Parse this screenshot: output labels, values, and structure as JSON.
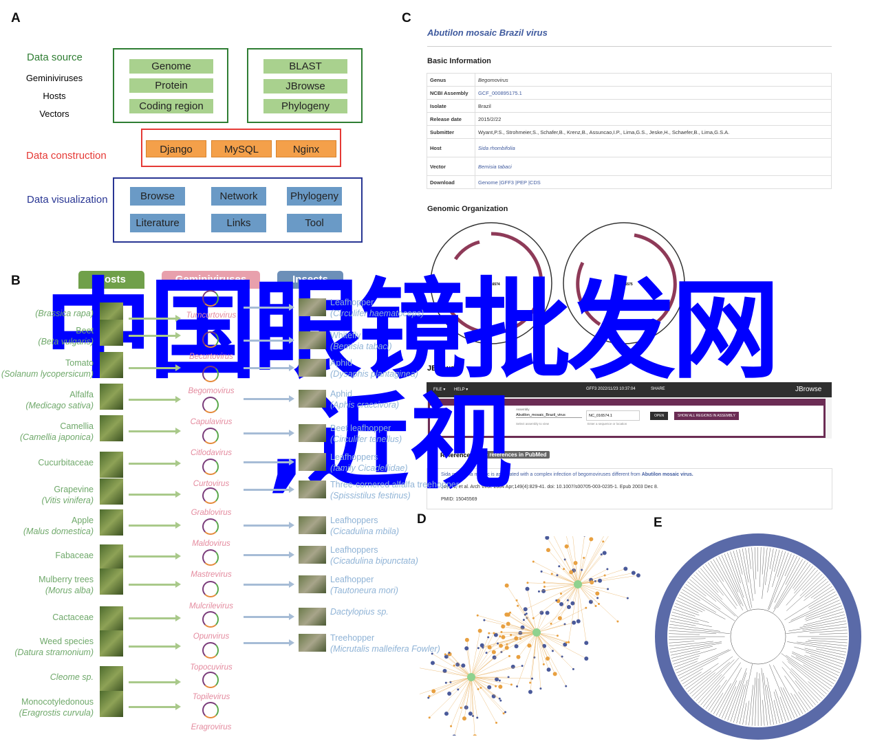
{
  "panels": {
    "a": "A",
    "b": "B",
    "c": "C",
    "d": "D",
    "e": "E"
  },
  "panel_a": {
    "data_source": "Data source",
    "sources": [
      "Geminiviruses",
      "Hosts",
      "Vectors"
    ],
    "data_construction": "Data construction",
    "data_visualization": "Data visualization",
    "source_box1": [
      "Genome",
      "Protein",
      "Coding region"
    ],
    "source_box2": [
      "BLAST",
      "JBrowse",
      "Phylogeny"
    ],
    "construction": [
      "Django",
      "MySQL",
      "Nginx"
    ],
    "visualization": [
      "Browse",
      "Network",
      "Phylogeny",
      "Literature",
      "Links",
      "Tool"
    ],
    "colors": {
      "source": "#2e7d32",
      "construction": "#e53935",
      "visualization": "#283593"
    }
  },
  "panel_b": {
    "headers": [
      "Hosts",
      "Geminiviruses",
      "Insects"
    ],
    "hosts": [
      {
        "name": "",
        "latin": "(Brassica rapa)"
      },
      {
        "name": "Beet",
        "latin": "(Beta vulgaris)"
      },
      {
        "name": "Tomato",
        "latin": "(Solanum lycopersicum)"
      },
      {
        "name": "Alfalfa",
        "latin": "(Medicago sativa)"
      },
      {
        "name": "Camellia",
        "latin": "(Camellia japonica)"
      },
      {
        "name": "Cucurbitaceae",
        "latin": ""
      },
      {
        "name": "Grapevine",
        "latin": "(Vitis vinifera)"
      },
      {
        "name": "Apple",
        "latin": "(Malus domestica)"
      },
      {
        "name": "Fabaceae",
        "latin": ""
      },
      {
        "name": "Mulberry trees",
        "latin": "(Morus alba)"
      },
      {
        "name": "Cactaceae",
        "latin": ""
      },
      {
        "name": "Weed species",
        "latin": "(Datura stramonium)"
      },
      {
        "name": "",
        "latin": "Cleome sp."
      },
      {
        "name": "Monocotyledonous",
        "latin": "(Eragrostis curvula)"
      }
    ],
    "viruses": [
      "Turncurtovirus",
      "Becurtovirus",
      "Begomovirus",
      "Capulavirus",
      "Citlodavirus",
      "Curtovirus",
      "Grablovirus",
      "Maldovirus",
      "Mastrevirus",
      "Mulcrilevirus",
      "Opunvirus",
      "Topocuvirus",
      "Topilevirus",
      "Eragrovirus"
    ],
    "insects": [
      {
        "name": "Leafhopper",
        "latin": "(Circulifer haematoceps)"
      },
      {
        "name": "Whitefly",
        "latin": "(Bemisia tabaci)"
      },
      {
        "name": "Aphid",
        "latin": "(Dysaphis plantaginea)"
      },
      {
        "name": "Aphid",
        "latin": "(Aphis craccivora)"
      },
      {
        "name": "Beet leafhopper",
        "latin": "(Circulifer tenellus)"
      },
      {
        "name": "Leafhoppers",
        "latin": "(family Cicadellidae)"
      },
      {
        "name": "Three-cornered alfalfa treehopper",
        "latin": "(Spissistilus festinus)"
      },
      {
        "name": "Leafhoppers",
        "latin": "(Cicadulina mbila)"
      },
      {
        "name": "Leafhoppers",
        "latin": "(Cicadulina bipunctata)"
      },
      {
        "name": "Leafhopper",
        "latin": "(Tautoneura mori)"
      },
      {
        "name": "",
        "latin": "Dactylopius sp."
      },
      {
        "name": "Treehopper",
        "latin": "(Micrutalis malleifera Fowler)"
      }
    ],
    "colors": {
      "hosts": "#70a04a",
      "viruses": "#e8a0ac",
      "insects": "#6c8fb8"
    }
  },
  "panel_c": {
    "title": "Abutilon mosaic Brazil virus",
    "basic_info": "Basic Information",
    "rows": [
      [
        "Genus",
        "Begomovirus"
      ],
      [
        "NCBI Assembly",
        "GCF_000895175.1"
      ],
      [
        "Isolate",
        "Brazil"
      ],
      [
        "Release date",
        "2015/2/22"
      ],
      [
        "Submitter",
        "Wyant,P.S., Strohmeier,S., Schafer,B., Krenz,B., Assuncao,I.P., Lima,G.S., Jeske,H., Schaefer,B., Lima,G.S.A."
      ],
      [
        "Host",
        "Sida rhombifolia"
      ],
      [
        "Vector",
        "Bemisia tabaci"
      ],
      [
        "Download",
        "Genome |GFF3 |PEP |CDS"
      ]
    ],
    "genomic_org": "Genomic Organization",
    "genome_labels": [
      "NC_016574",
      "NC_016575"
    ],
    "jbrowse_title": "JBrowse",
    "jbrowse": {
      "file": "FILE ▾",
      "help": "HELP ▾",
      "session": "GFF3 2022/11/23 10:37:04",
      "share": "SHARE",
      "logo": "JBrowse",
      "assembly_label": "Assembly",
      "assembly": "Abutilon_mosaic_Brazil_virus",
      "assembly_help": "Select assembly to view",
      "locus": "NC_016574.1",
      "locus_help": "Enter a sequence or location",
      "open": "OPEN",
      "show_all": "SHOW ALL REGIONS IN ASSEMBLY"
    },
    "refs_label": "Reference",
    "pubmed_button": "More references in PubMed",
    "ref": {
      "num": "1",
      "title_pre": "Sida micrantha mosaic is associated with a complex infection of begomoviruses different from ",
      "title_bold": "Abutilon mosaic virus.",
      "cite": "Jovel J, et al. Arch Virol. 2004 Apr;149(4):829-41. doi: 10.1007/s00705-003-0235-1. Epub 2003 Dec 8.",
      "pmid": "PMID: 15045569"
    }
  },
  "watermark": {
    "line1": "中国眼镜批发网",
    ",line2": "",
    ",": "",
    "line2_text": ",近视",
    "color": "#0000ff"
  }
}
